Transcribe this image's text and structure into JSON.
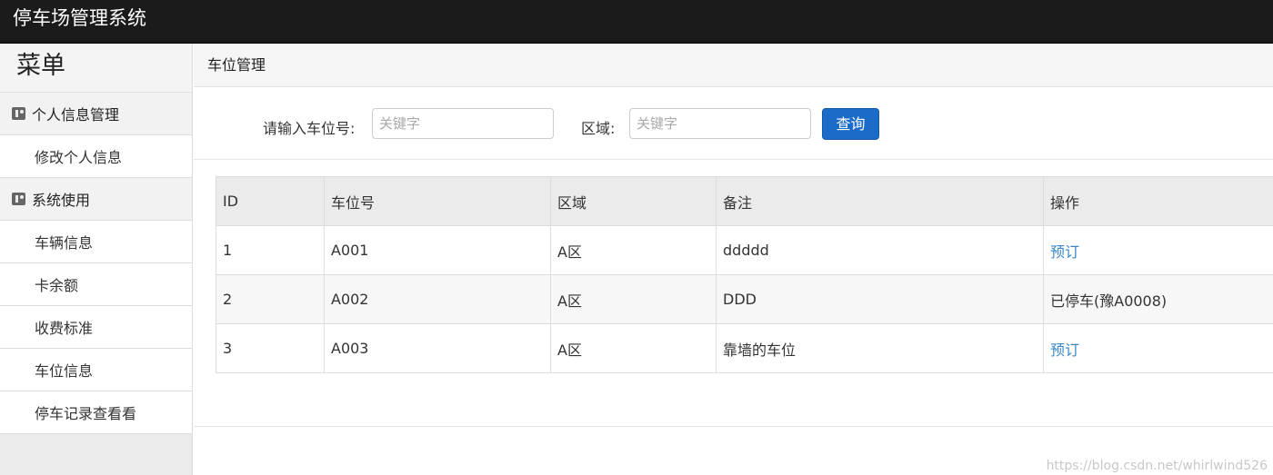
{
  "header": {
    "title": "停车场管理系统"
  },
  "sidebar": {
    "title": "菜单",
    "groups": [
      {
        "label": "个人信息管理",
        "items": [
          "修改个人信息"
        ]
      },
      {
        "label": "系统使用",
        "items": [
          "车辆信息",
          "卡余额",
          "收费标准",
          "车位信息",
          "停车记录查看看"
        ]
      }
    ]
  },
  "main": {
    "breadcrumb": "车位管理",
    "search": {
      "slot_label": "请输入车位号:",
      "slot_placeholder": "关键字",
      "area_label": "区域:",
      "area_placeholder": "关键字",
      "button": "查询"
    },
    "table": {
      "headers": [
        "ID",
        "车位号",
        "区域",
        "备注",
        "操作"
      ],
      "rows": [
        {
          "id": "1",
          "slot": "A001",
          "area": "A区",
          "note": "ddddd",
          "action": "预订",
          "action_link": true
        },
        {
          "id": "2",
          "slot": "A002",
          "area": "A区",
          "note": "DDD",
          "action": "已停车(豫A0008)",
          "action_link": false
        },
        {
          "id": "3",
          "slot": "A003",
          "area": "A区",
          "note": "靠墙的车位",
          "action": "预订",
          "action_link": true
        }
      ]
    }
  },
  "watermark": "https://blog.csdn.net/whirlwind526",
  "colors": {
    "topbar": "#1b1b1b",
    "button": "#1a6cc8",
    "link": "#3a86c8"
  }
}
